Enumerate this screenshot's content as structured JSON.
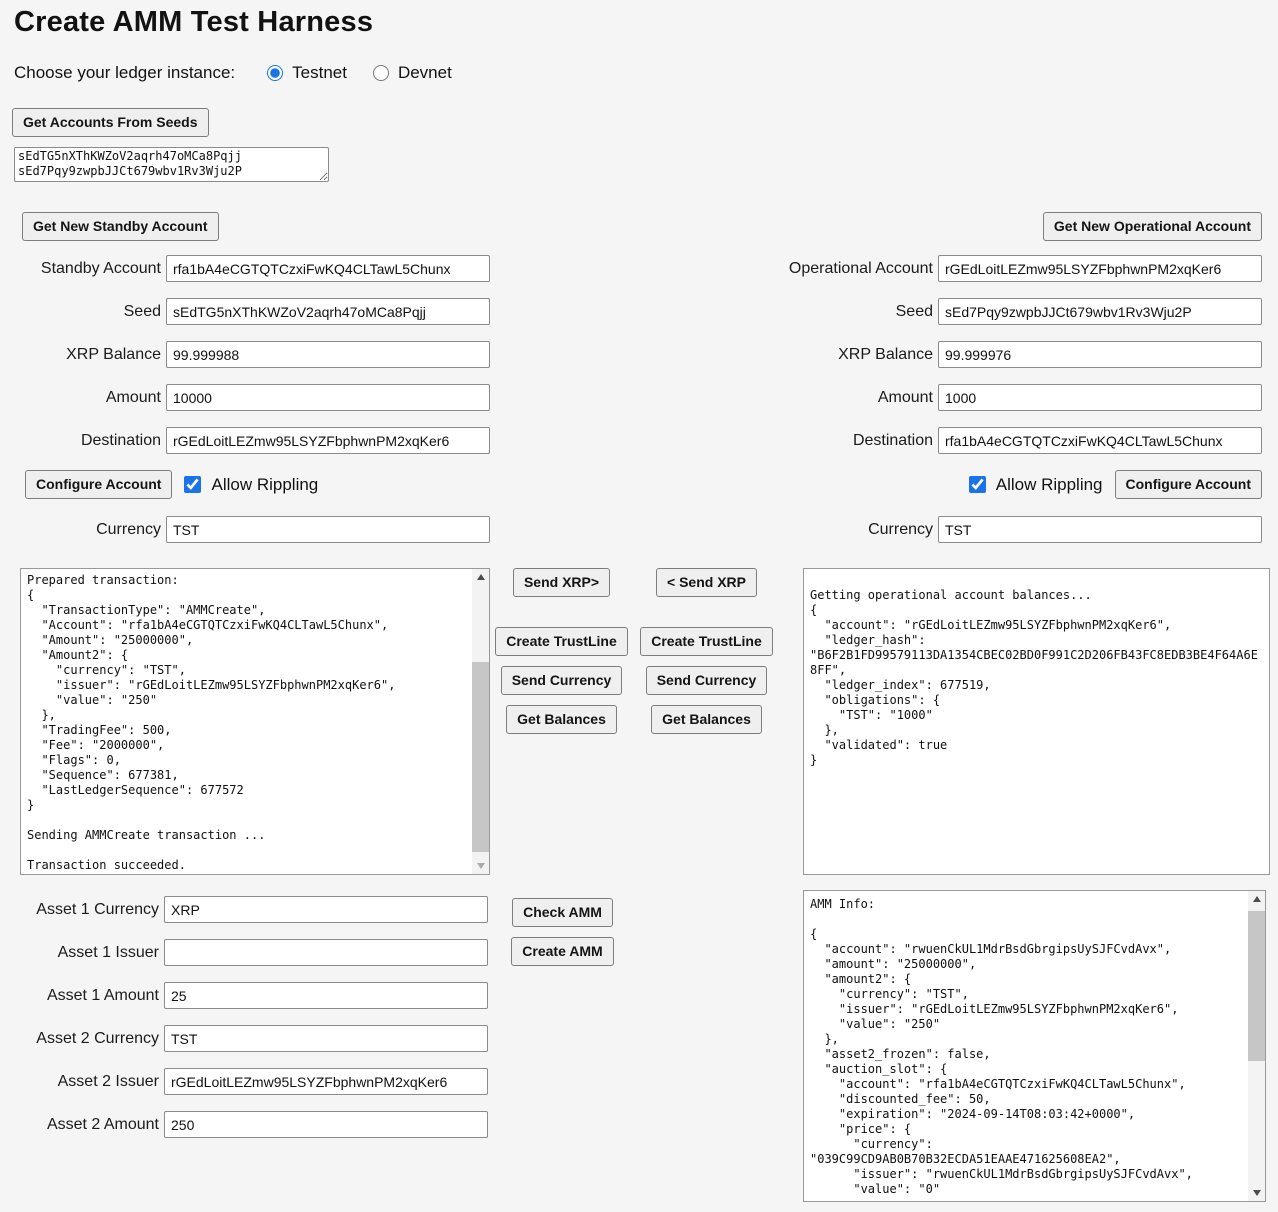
{
  "header": {
    "title": "Create AMM Test Harness"
  },
  "ledger_chooser": {
    "label": "Choose your ledger instance:",
    "options": [
      {
        "label": "Testnet",
        "selected": true
      },
      {
        "label": "Devnet",
        "selected": false
      }
    ]
  },
  "seeds_section": {
    "get_accounts_button": "Get Accounts From Seeds",
    "seeds_value": "sEdTG5nXThKWZoV2aqrh47oMCa8Pqjj\nsEd7Pqy9zwpbJJCt679wbv1Rv3Wju2P"
  },
  "standby": {
    "get_new_account_button": "Get New Standby Account",
    "fields": {
      "account": {
        "label": "Standby Account",
        "value": "rfa1bA4eCGTQTCzxiFwKQ4CLTawL5Chunx"
      },
      "seed": {
        "label": "Seed",
        "value": "sEdTG5nXThKWZoV2aqrh47oMCa8Pqjj"
      },
      "xrp_balance": {
        "label": "XRP Balance",
        "value": "99.999988"
      },
      "amount": {
        "label": "Amount",
        "value": "10000"
      },
      "destination": {
        "label": "Destination",
        "value": "rGEdLoitLEZmw95LSYZFbphwnPM2xqKer6"
      },
      "currency": {
        "label": "Currency",
        "value": "TST"
      }
    },
    "configure_button": "Configure Account",
    "allow_rippling": {
      "label": "Allow Rippling",
      "checked": true
    }
  },
  "operational": {
    "get_new_account_button": "Get New Operational Account",
    "fields": {
      "account": {
        "label": "Operational Account",
        "value": "rGEdLoitLEZmw95LSYZFbphwnPM2xqKer6"
      },
      "seed": {
        "label": "Seed",
        "value": "sEd7Pqy9zwpbJJCt679wbv1Rv3Wju2P"
      },
      "xrp_balance": {
        "label": "XRP Balance",
        "value": "99.999976"
      },
      "amount": {
        "label": "Amount",
        "value": "1000"
      },
      "destination": {
        "label": "Destination",
        "value": "rfa1bA4eCGTQTCzxiFwKQ4CLTawL5Chunx"
      },
      "currency": {
        "label": "Currency",
        "value": "TST"
      }
    },
    "configure_button": "Configure Account",
    "allow_rippling": {
      "label": "Allow Rippling",
      "checked": true
    }
  },
  "actions": {
    "standby": {
      "send_xrp": "Send XRP>",
      "create_trustline": "Create TrustLine",
      "send_currency": "Send Currency",
      "get_balances": "Get Balances"
    },
    "operational": {
      "send_xrp": "< Send XRP",
      "create_trustline": "Create TrustLine",
      "send_currency": "Send Currency",
      "get_balances": "Get Balances"
    }
  },
  "logs": {
    "standby_results": "Prepared transaction:\n{\n  \"TransactionType\": \"AMMCreate\",\n  \"Account\": \"rfa1bA4eCGTQTCzxiFwKQ4CLTawL5Chunx\",\n  \"Amount\": \"25000000\",\n  \"Amount2\": {\n    \"currency\": \"TST\",\n    \"issuer\": \"rGEdLoitLEZmw95LSYZFbphwnPM2xqKer6\",\n    \"value\": \"250\"\n  },\n  \"TradingFee\": 500,\n  \"Fee\": \"2000000\",\n  \"Flags\": 0,\n  \"Sequence\": 677381,\n  \"LastLedgerSequence\": 677572\n}\n\nSending AMMCreate transaction ...\n\nTransaction succeeded.",
    "operational_results": "\nGetting operational account balances...\n{\n  \"account\": \"rGEdLoitLEZmw95LSYZFbphwnPM2xqKer6\",\n  \"ledger_hash\":\n\"B6F2B1FD99579113DA1354CBEC02BD0F991C2D206FB43FC8EDB3BE4F64A6E\n8FF\",\n  \"ledger_index\": 677519,\n  \"obligations\": {\n    \"TST\": \"1000\"\n  },\n  \"validated\": true\n}",
    "amm_info": "AMM Info:\n\n{\n  \"account\": \"rwuenCkUL1MdrBsdGbrgipsUySJFCvdAvx\",\n  \"amount\": \"25000000\",\n  \"amount2\": {\n    \"currency\": \"TST\",\n    \"issuer\": \"rGEdLoitLEZmw95LSYZFbphwnPM2xqKer6\",\n    \"value\": \"250\"\n  },\n  \"asset2_frozen\": false,\n  \"auction_slot\": {\n    \"account\": \"rfa1bA4eCGTQTCzxiFwKQ4CLTawL5Chunx\",\n    \"discounted_fee\": 50,\n    \"expiration\": \"2024-09-14T08:03:42+0000\",\n    \"price\": {\n      \"currency\":\n\"039C99CD9AB0B70B32ECDA51EAAE471625608EA2\",\n      \"issuer\": \"rwuenCkUL1MdrBsdGbrgipsUySJFCvdAvx\",\n      \"value\": \"0\""
  },
  "amm": {
    "check_button": "Check AMM",
    "create_button": "Create AMM",
    "fields": {
      "asset1_currency": {
        "label": "Asset 1 Currency",
        "value": "XRP"
      },
      "asset1_issuer": {
        "label": "Asset 1 Issuer",
        "value": ""
      },
      "asset1_amount": {
        "label": "Asset 1 Amount",
        "value": "25"
      },
      "asset2_currency": {
        "label": "Asset 2 Currency",
        "value": "TST"
      },
      "asset2_issuer": {
        "label": "Asset 2 Issuer",
        "value": "rGEdLoitLEZmw95LSYZFbphwnPM2xqKer6"
      },
      "asset2_amount": {
        "label": "Asset 2 Amount",
        "value": "250"
      }
    }
  },
  "colors": {
    "accent_blue": "#1a73e8",
    "page_background": "#f5f5f6",
    "button_background": "#efefef"
  }
}
